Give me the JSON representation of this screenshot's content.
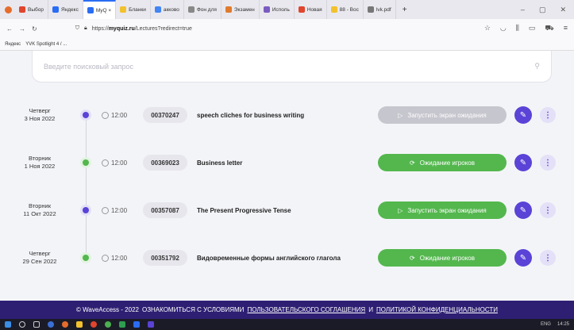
{
  "browser": {
    "tabs": [
      {
        "label": "Выбор",
        "color": "#e0452d"
      },
      {
        "label": "Яндекс",
        "color": "#2a6df4"
      },
      {
        "label": "MyQ ×",
        "color": "#2a6df4",
        "active": true
      },
      {
        "label": "Бланки",
        "color": "#f2c12e"
      },
      {
        "label": "акково",
        "color": "#4285f4"
      },
      {
        "label": "Фон для",
        "color": "#888888"
      },
      {
        "label": "Экзамен",
        "color": "#e07b2d"
      },
      {
        "label": "Исполь",
        "color": "#7a5cc0"
      },
      {
        "label": "Новая",
        "color": "#e0452d"
      },
      {
        "label": "88 - Вос",
        "color": "#f2c12e"
      },
      {
        "label": "lvk.pdf",
        "color": "#777777"
      }
    ],
    "new_tab": "+",
    "window_controls": [
      "–",
      "▢",
      "✕"
    ],
    "url_prefix": "https://",
    "url_domain": "myquiz.ru",
    "url_path": "/Lectures?redirect=true",
    "bookmarks": [
      "Яндекс",
      "YVK Spotlight 4 / ..."
    ]
  },
  "search": {
    "placeholder": "Введите поисковый запрос"
  },
  "lectures": [
    {
      "day": "Четверг",
      "date": "3 Ноя 2022",
      "dot": "purple",
      "time": "12:00",
      "code": "00370247",
      "title": "speech cliches for business writing",
      "button": "Запустить экран ожидания",
      "button_style": "grey",
      "button_icon": "▷"
    },
    {
      "day": "Вторник",
      "date": "1 Ноя 2022",
      "dot": "green",
      "time": "12:00",
      "code": "00369023",
      "title": "Business letter",
      "button": "Ожидание игроков",
      "button_style": "green",
      "button_icon": "⟳"
    },
    {
      "day": "Вторник",
      "date": "11 Окт 2022",
      "dot": "purple",
      "time": "12:00",
      "code": "00357087",
      "title": "The Present Progressive Tense",
      "button": "Запустить экран ожидания",
      "button_style": "green",
      "button_icon": "▷"
    },
    {
      "day": "Четверг",
      "date": "29 Сен 2022",
      "dot": "green",
      "time": "12:00",
      "code": "00351792",
      "title": "Видовременные формы английского глагола",
      "button": "Ожидание игроков",
      "button_style": "green",
      "button_icon": "⟳"
    }
  ],
  "footer": {
    "copyright": "© WaveAccess - 2022",
    "prefix": "ОЗНАКОМИТЬСЯ С УСЛОВИЯМИ",
    "agreement_link": "ПОЛЬЗОВАТЕЛЬСКОГО СОГЛАШЕНИЯ",
    "and": "И",
    "privacy_link": "ПОЛИТИКОЙ КОНФИДЕНЦИАЛЬНОСТИ"
  },
  "taskbar": {
    "lang": "ENG",
    "time": "14:25"
  },
  "colors": {
    "accent": "#5a43d6",
    "success": "#53b74d",
    "footer_bg": "#2e1f73"
  }
}
